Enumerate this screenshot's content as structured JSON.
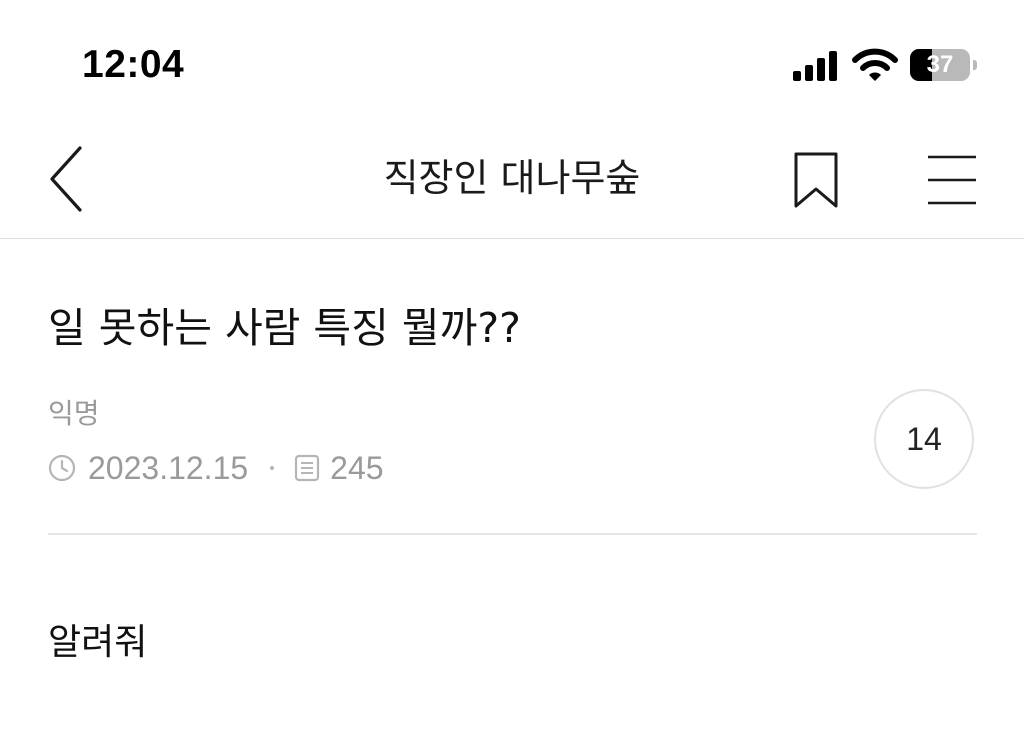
{
  "status_bar": {
    "time": "12:04",
    "battery_level": "37",
    "battery_fraction": 0.37
  },
  "nav": {
    "title": "직장인 대나무숲",
    "back_icon": "chevron-left-icon",
    "bookmark_icon": "bookmark-icon",
    "menu_icon": "hamburger-menu-icon"
  },
  "post": {
    "title": "일 못하는 사람 특징 뭘까??",
    "author": "익명",
    "date": "2023.12.15",
    "views": "245",
    "comment_count": "14",
    "body": "알려줘"
  },
  "colors": {
    "text_primary": "#111111",
    "text_secondary": "#9a9a9a",
    "divider": "#e6e6e6",
    "circle_border": "#e1e1e1"
  }
}
